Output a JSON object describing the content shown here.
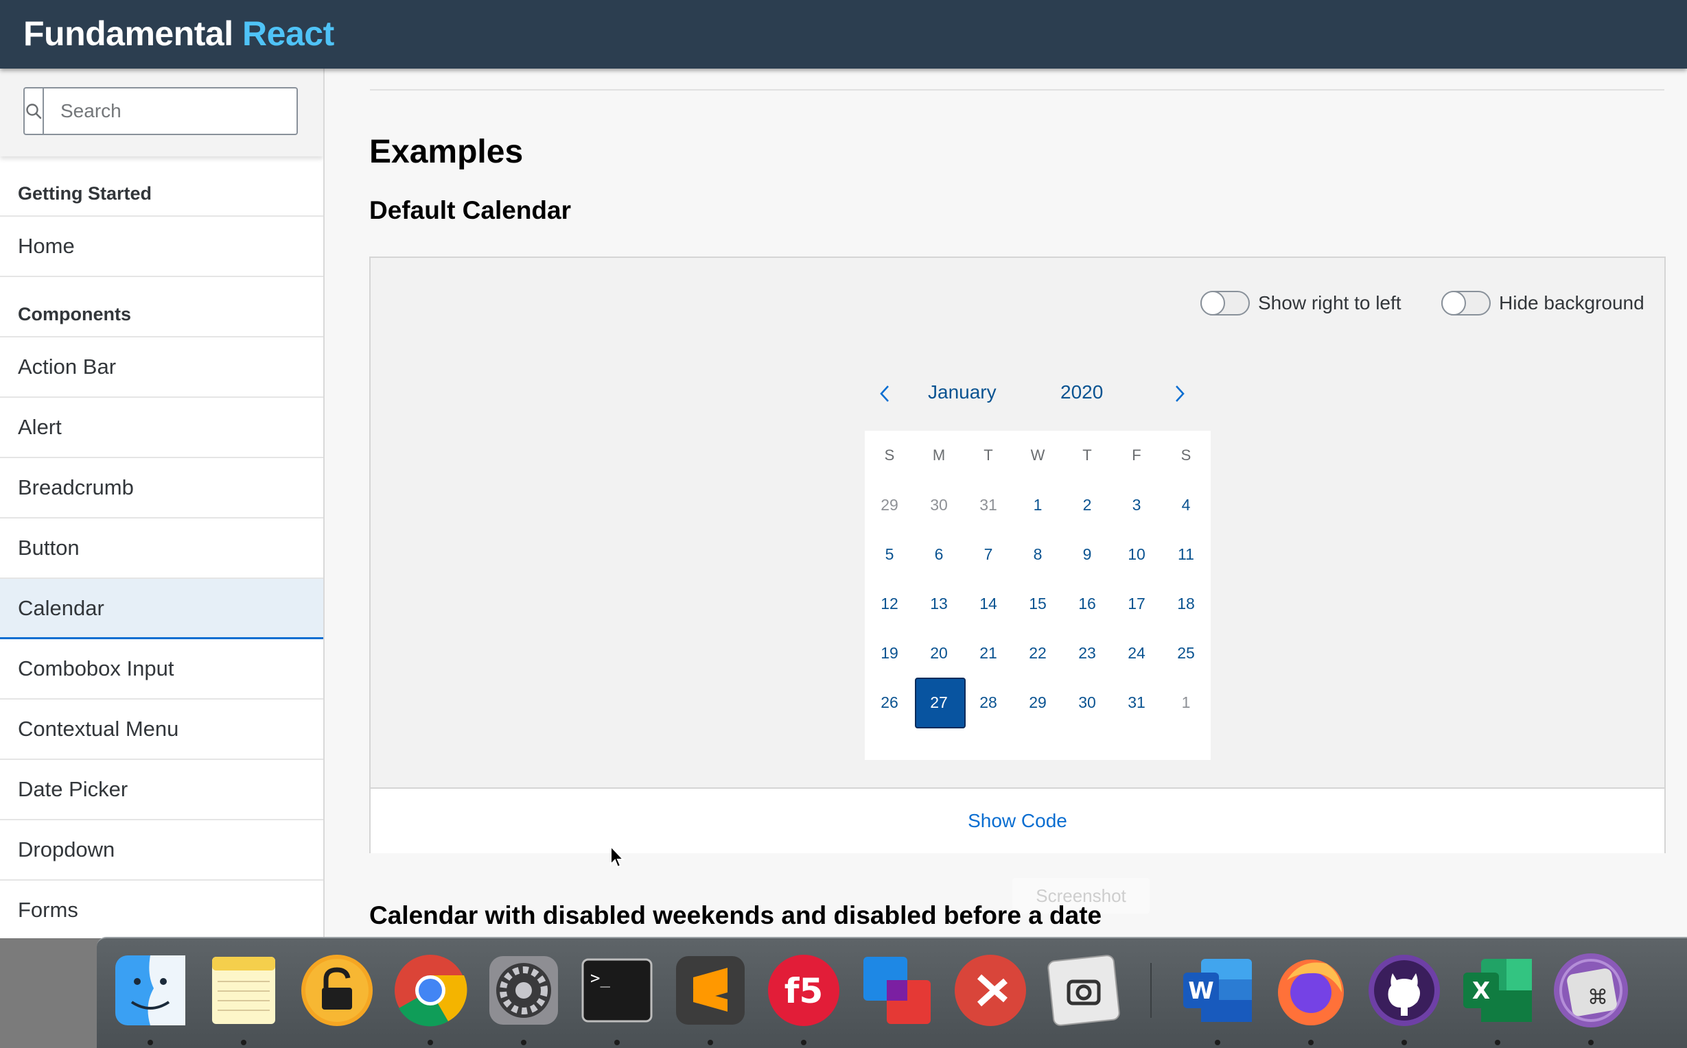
{
  "header": {
    "title_main": "Fundamental",
    "title_accent": "React"
  },
  "sidebar": {
    "search_placeholder": "Search",
    "groups": [
      {
        "title": "Getting Started",
        "items": [
          "Home"
        ]
      },
      {
        "title": "Components",
        "items": [
          "Action Bar",
          "Alert",
          "Breadcrumb",
          "Button",
          "Calendar",
          "Combobox Input",
          "Contextual Menu",
          "Date Picker",
          "Dropdown",
          "Forms"
        ]
      }
    ],
    "selected_item": "Calendar"
  },
  "main": {
    "examples_heading": "Examples",
    "default_calendar_heading": "Default Calendar",
    "toggles": {
      "rtl_label": "Show right to left",
      "bg_label": "Hide background"
    },
    "calendar": {
      "month": "January",
      "year": "2020",
      "weekdays": [
        "S",
        "M",
        "T",
        "W",
        "T",
        "F",
        "S"
      ],
      "days": [
        [
          "29",
          "30",
          "31",
          "1",
          "2",
          "3",
          "4"
        ],
        [
          "5",
          "6",
          "7",
          "8",
          "9",
          "10",
          "11"
        ],
        [
          "12",
          "13",
          "14",
          "15",
          "16",
          "17",
          "18"
        ],
        [
          "19",
          "20",
          "21",
          "22",
          "23",
          "24",
          "25"
        ],
        [
          "26",
          "27",
          "28",
          "29",
          "30",
          "31",
          "1"
        ]
      ],
      "selected_day": "27"
    },
    "show_code_label": "Show Code",
    "screenshot_label": "Screenshot",
    "disabled_calendar_heading": "Calendar with disabled weekends and disabled before a date"
  },
  "dock": {
    "apps": [
      "finder-icon",
      "notes-icon",
      "lock-icon",
      "chrome-icon",
      "system-preferences-icon",
      "terminal-icon",
      "sublime-text-icon",
      "f5-icon",
      "vmware-icon",
      "remote-desktop-icon",
      "screenshot-icon",
      "word-icon",
      "firefox-icon",
      "github-icon",
      "excel-icon",
      "keyboard-icon"
    ]
  }
}
